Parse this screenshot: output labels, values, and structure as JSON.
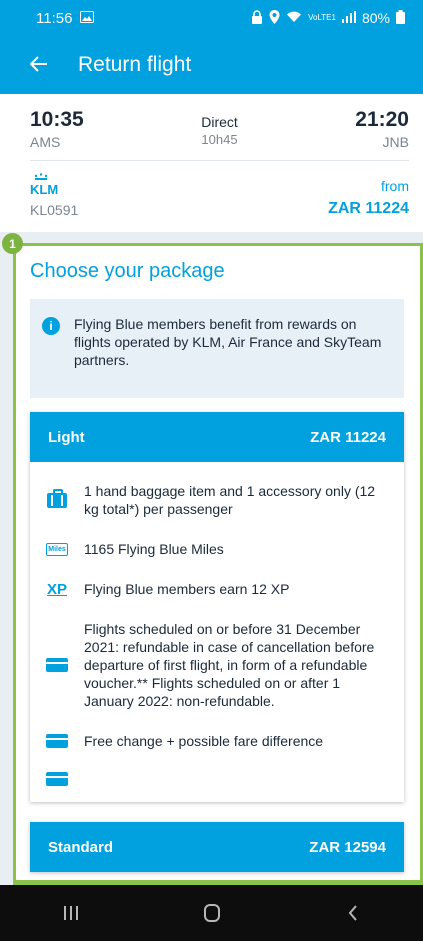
{
  "status_bar": {
    "time": "11:56",
    "signal_label": "VoLTE1",
    "battery": "80%"
  },
  "app_bar": {
    "back_icon": "arrow-left-icon",
    "title": "Return flight"
  },
  "flight": {
    "departure_time": "10:35",
    "departure_code": "AMS",
    "stop_type": "Direct",
    "duration": "10h45",
    "arrival_time": "21:20",
    "arrival_code": "JNB",
    "airline_logo": "KLM",
    "flight_number": "KL0591",
    "from_label": "from",
    "from_price": "ZAR 11224"
  },
  "marker_number": "1",
  "section_title": "Choose your package",
  "info_box": {
    "icon": "info-icon",
    "text": "Flying Blue members benefit from rewards on flights operated by KLM, Air France and SkyTeam partners."
  },
  "packages": [
    {
      "name": "Light",
      "price": "ZAR 11224",
      "features": [
        {
          "icon": "baggage-icon",
          "text": "1 hand baggage item and 1 accessory only (12 kg total*) per passenger"
        },
        {
          "icon": "miles-icon",
          "text": "1165 Flying Blue Miles"
        },
        {
          "icon": "xp-icon",
          "text": "Flying Blue members earn 12 XP"
        },
        {
          "icon": "card-icon",
          "text": "Flights scheduled on or before 31 December 2021: refundable in case of cancellation before departure of first flight, in form of a refundable voucher.** Flights scheduled on or after 1 January 2022: non-refundable."
        },
        {
          "icon": "card-icon",
          "text": "Free change + possible fare difference"
        },
        {
          "icon": "card-icon",
          "text": ""
        }
      ]
    },
    {
      "name": "Standard",
      "price": "ZAR 12594"
    }
  ],
  "nav_bar": {
    "recents_icon": "recents-icon",
    "home_icon": "home-icon",
    "back_icon": "back-chevron-icon"
  }
}
